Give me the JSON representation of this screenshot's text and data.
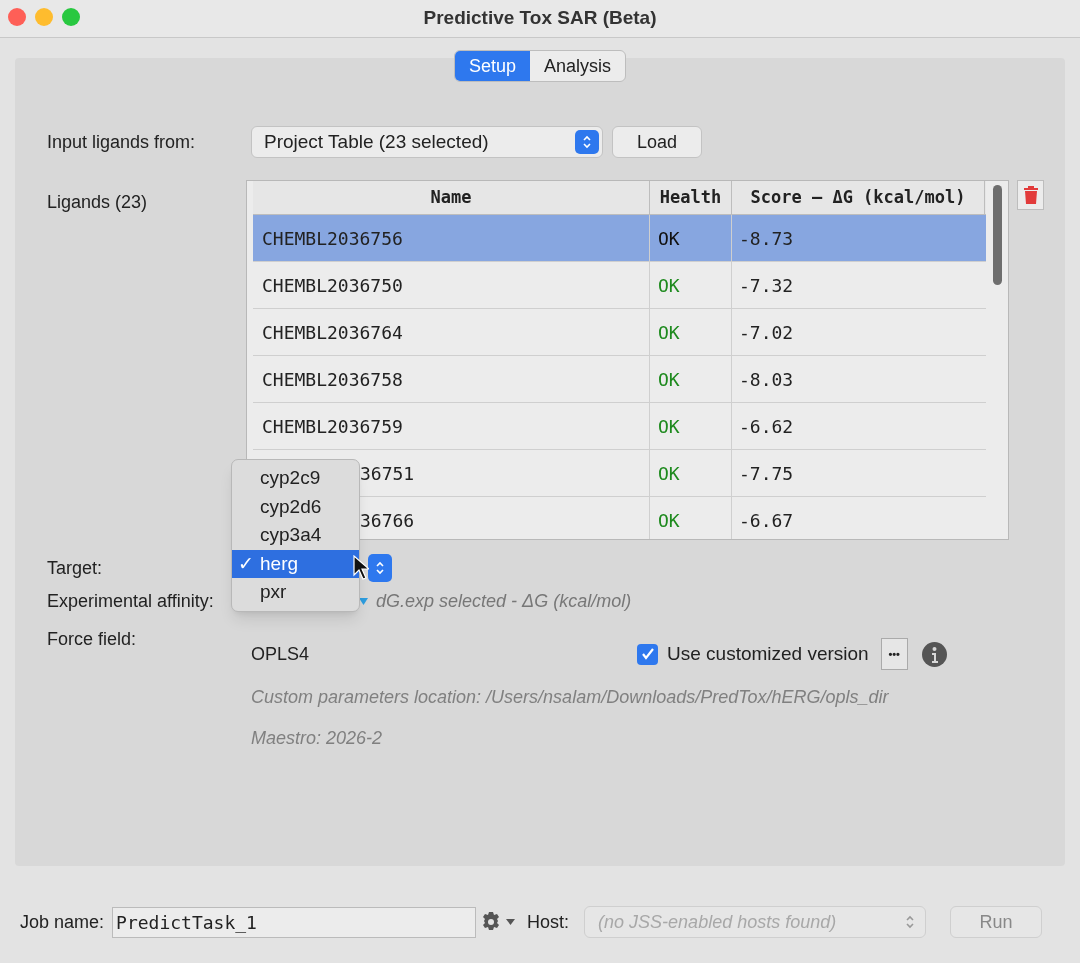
{
  "window": {
    "title": "Predictive Tox SAR (Beta)"
  },
  "tabs": [
    {
      "label": "Setup",
      "selected": true
    },
    {
      "label": "Analysis",
      "selected": false
    }
  ],
  "input_ligands": {
    "label": "Input ligands from:",
    "source": "Project Table (23 selected)",
    "load_button": "Load"
  },
  "ligands": {
    "label": "Ligands (23)",
    "columns": [
      "Name",
      "Health",
      "Score – ΔG (kcal/mol)"
    ],
    "rows": [
      {
        "name": "CHEMBL2036756",
        "health": "OK",
        "score": "-8.73",
        "selected": true,
        "partly_hidden": false
      },
      {
        "name": "CHEMBL2036750",
        "health": "OK",
        "score": "-7.32",
        "selected": false,
        "partly_hidden": false
      },
      {
        "name": "CHEMBL2036764",
        "health": "OK",
        "score": "-7.02",
        "selected": false,
        "partly_hidden": false
      },
      {
        "name": "CHEMBL2036758",
        "health": "OK",
        "score": "-8.03",
        "selected": false,
        "partly_hidden": false
      },
      {
        "name": "CHEMBL2036759",
        "health": "OK",
        "score": "-6.62",
        "selected": false,
        "partly_hidden": false
      },
      {
        "name": "36751",
        "health": "OK",
        "score": "-7.75",
        "selected": false,
        "partly_hidden": true
      },
      {
        "name": "36766",
        "health": "OK",
        "score": "-6.67",
        "selected": false,
        "partly_hidden": true
      }
    ]
  },
  "target": {
    "label": "Target:",
    "menu": [
      {
        "label": "cyp2c9",
        "selected": false
      },
      {
        "label": "cyp2d6",
        "selected": false
      },
      {
        "label": "cyp3a4",
        "selected": false
      },
      {
        "label": "herg",
        "selected": true
      },
      {
        "label": "pxr",
        "selected": false
      }
    ],
    "check_mark": "✓"
  },
  "experimental_affinity": {
    "label": "Experimental affinity:",
    "value": "dG.exp selected - ΔG (kcal/mol)"
  },
  "force_field": {
    "label": "Force field:",
    "value": "OPLS4",
    "use_customized": {
      "label": "Use customized version",
      "checked": true
    },
    "more_button": "•••",
    "custom_location": "Custom parameters location: /Users/nsalam/Downloads/PredTox/hERG/opls_dir",
    "maestro": "Maestro: 2026-2"
  },
  "footer": {
    "job_label": "Job name:",
    "job_name": "PredictTask_1",
    "host_label": "Host:",
    "host_placeholder": "(no JSS-enabled hosts found)",
    "run_button": "Run"
  }
}
